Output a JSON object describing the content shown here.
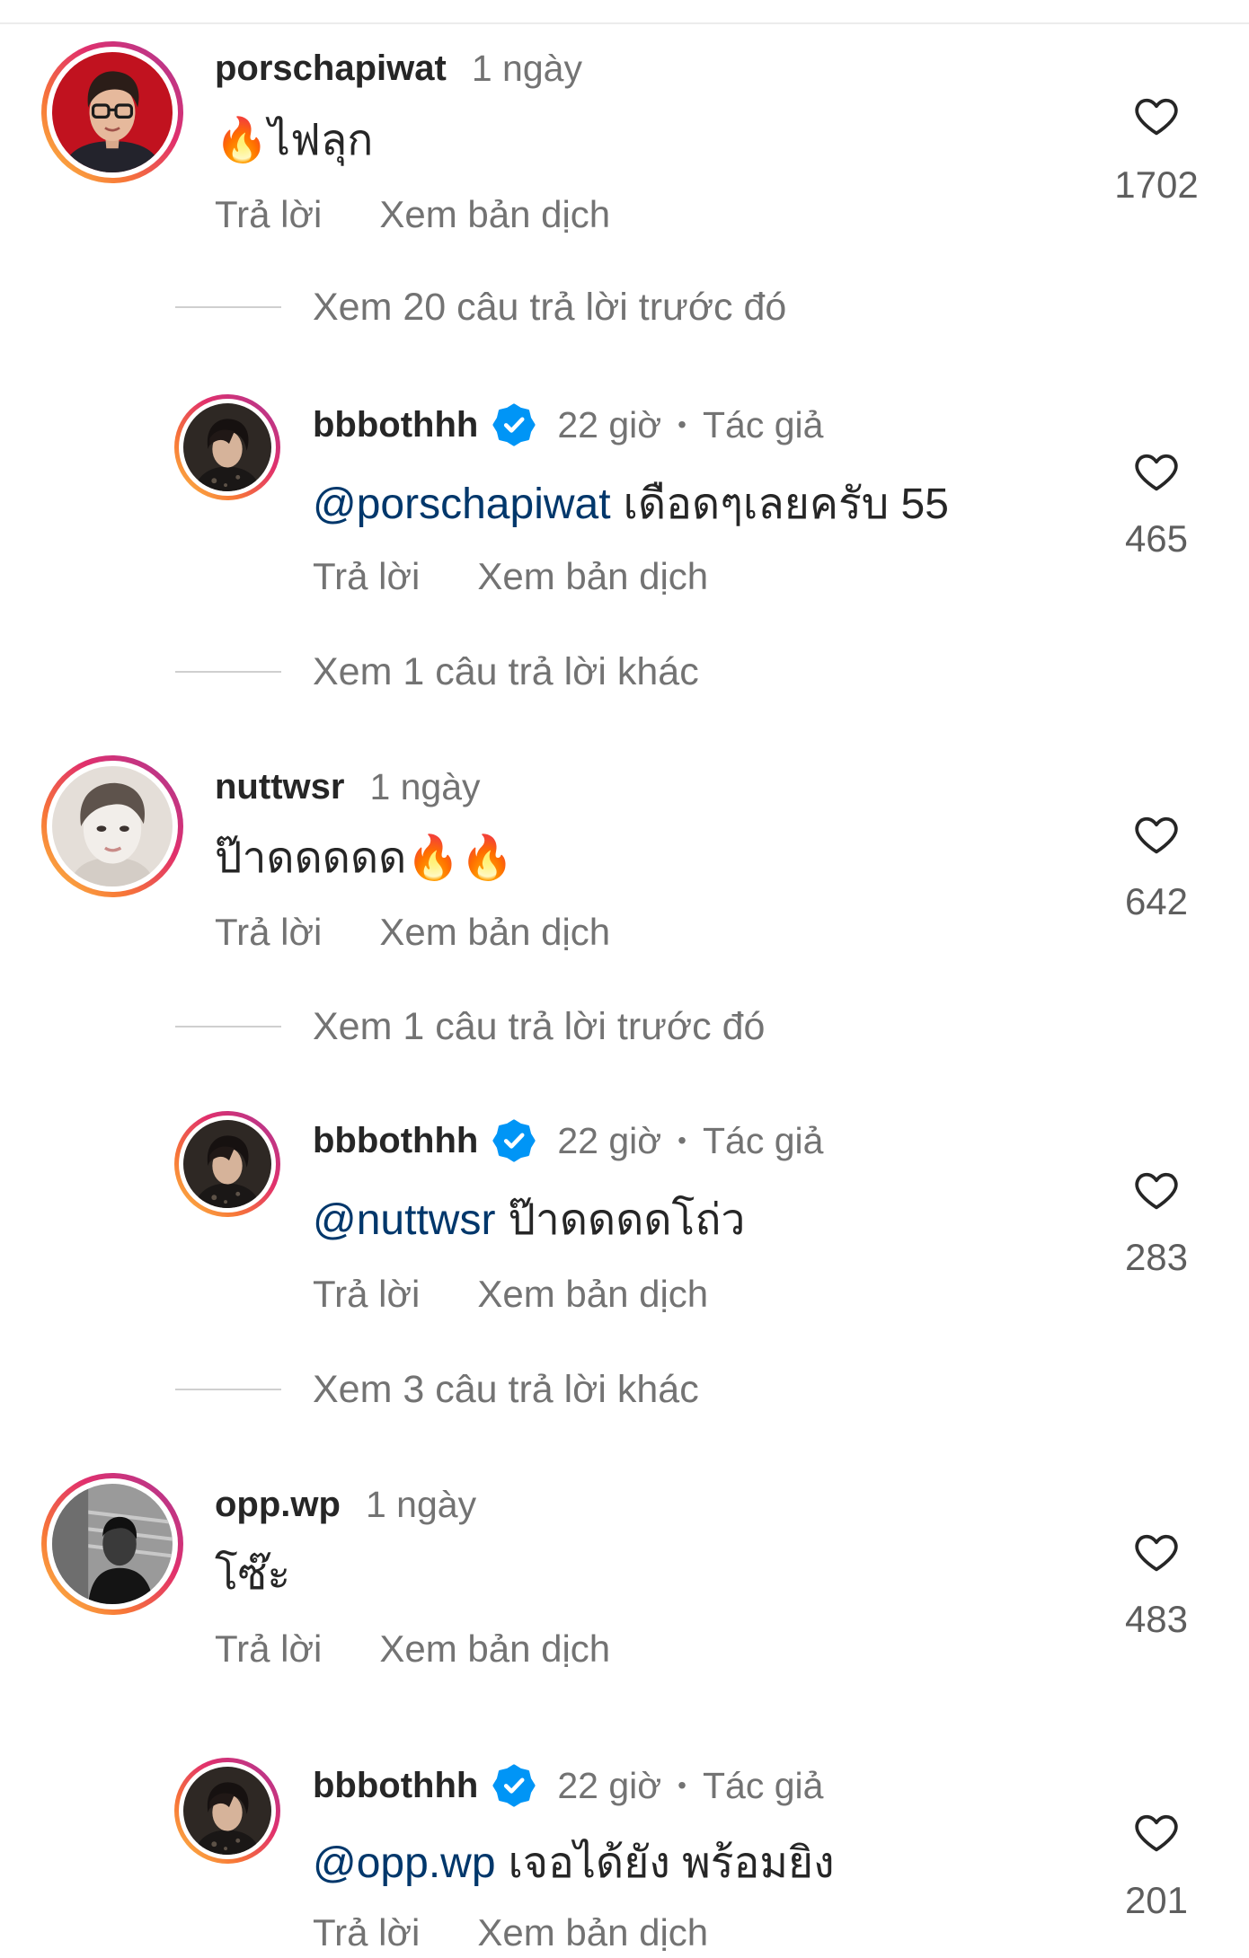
{
  "colors": {
    "text_primary": "#262626",
    "text_secondary": "#737373",
    "mention": "#00376b",
    "verified_badge": "#0095f6",
    "avatar_ring": [
      "#fcc447",
      "#f77737",
      "#e1306c",
      "#c13584"
    ]
  },
  "icons": {
    "like": "heart-icon",
    "verified": "verified-badge-icon"
  },
  "comments": [
    {
      "username": "porschapiwat",
      "time": "1 ngày",
      "text": "🔥ไฟลุก",
      "reply_label": "Trả lời",
      "translate_label": "Xem bản dịch",
      "likes": "1702",
      "view_earlier_replies": "Xem 20 câu trả lời trước đó",
      "reply": {
        "username": "bbbothhh",
        "verified": true,
        "time": "22 giờ",
        "separator": "•",
        "author_label": "Tác giả",
        "mention": "@porschapiwat",
        "text": "เดือดๆเลยครับ 55",
        "reply_label": "Trả lời",
        "translate_label": "Xem bản dịch",
        "likes": "465"
      },
      "view_more_replies": "Xem 1 câu trả lời khác"
    },
    {
      "username": "nuttwsr",
      "time": "1 ngày",
      "text": "ป๊าดดดดด🔥🔥",
      "reply_label": "Trả lời",
      "translate_label": "Xem bản dịch",
      "likes": "642",
      "view_earlier_replies": "Xem 1 câu trả lời trước đó",
      "reply": {
        "username": "bbbothhh",
        "verified": true,
        "time": "22 giờ",
        "separator": "•",
        "author_label": "Tác giả",
        "mention": "@nuttwsr",
        "text": "ป๊าดดดดโถ่ว",
        "reply_label": "Trả lời",
        "translate_label": "Xem bản dịch",
        "likes": "283"
      },
      "view_more_replies": "Xem 3 câu trả lời khác"
    },
    {
      "username": "opp.wp",
      "time": "1 ngày",
      "text": "โซ๊ะ",
      "reply_label": "Trả lời",
      "translate_label": "Xem bản dịch",
      "likes": "483",
      "reply": {
        "username": "bbbothhh",
        "verified": true,
        "time": "22 giờ",
        "separator": "•",
        "author_label": "Tác giả",
        "mention": "@opp.wp",
        "text": "เจอได้ยัง พร้อมยิง",
        "reply_label": "Trả lời",
        "translate_label": "Xem bản dịch",
        "likes": "201"
      }
    }
  ]
}
